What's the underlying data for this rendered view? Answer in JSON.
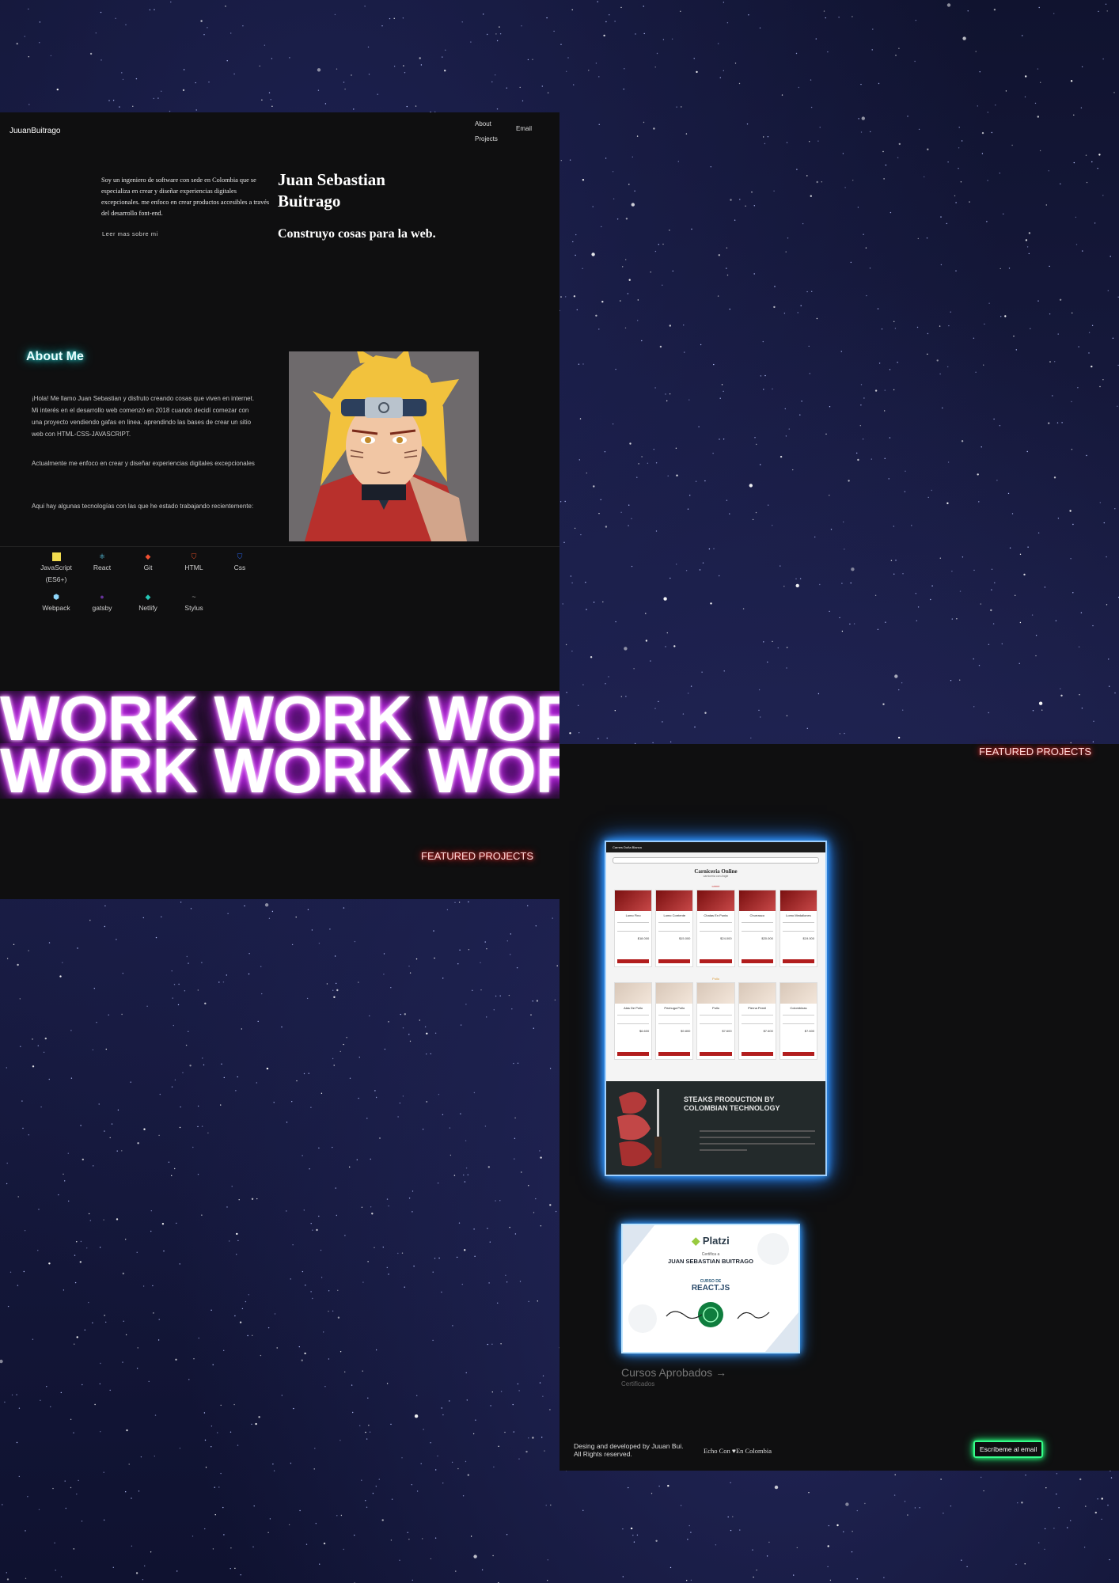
{
  "header": {
    "brand": "JuuanBuitrago",
    "nav": {
      "about": "About",
      "projects": "Projects",
      "email": "Email"
    }
  },
  "hero": {
    "intro": "Soy un ingeniero de software con sede en Colombia que se especializa en crear y diseñar experiencias digitales excepcionales. me enfoco en crear productos accesibles a través del desarrollo font-end.",
    "read_more": "Leer mas sobre mi",
    "name": "Juan Sebastian Buitrago",
    "tagline": "Construyo cosas para la web."
  },
  "about": {
    "title": "About Me",
    "paragraphs": [
      "¡Hola! Me llamo Juan Sebastian y disfruto creando cosas que viven en internet. Mi interés en el desarrollo web comenzó en 2018 cuando decidí comezar con una proyecto vendiendo gafas en linea. aprendindo las bases de crear un sitio web con HTML-CSS-JAVASCRIPT.",
      "Actualmente me enfoco en crear y diseñar experiencias digitales excepcionales",
      "Aqui hay algunas tecnologías con las que he estado trabajando recientemente:"
    ],
    "portrait_icon": "anime-portrait"
  },
  "technologies": [
    {
      "label": "JavaScript (ES6+)",
      "icon": "js-icon",
      "color": "#f0db4f"
    },
    {
      "label": "React",
      "icon": "react-icon",
      "color": "#61dafb"
    },
    {
      "label": "Git",
      "icon": "git-icon",
      "color": "#f05032"
    },
    {
      "label": "HTML",
      "icon": "html-icon",
      "color": "#e44d26"
    },
    {
      "label": "Css",
      "icon": "css-icon",
      "color": "#2965f1"
    },
    {
      "label": "Webpack",
      "icon": "webpack-icon",
      "color": "#8ed6fb"
    },
    {
      "label": "gatsby",
      "icon": "gatsby-icon",
      "color": "#663399"
    },
    {
      "label": "Netlify",
      "icon": "netlify-icon",
      "color": "#25c7b7"
    },
    {
      "label": "Stylus",
      "icon": "stylus-icon",
      "color": "#999999"
    }
  ],
  "marquee": {
    "row1": "WORK WORK WORK WORK",
    "row2": "WORK WORK WORK WORK",
    "glow_color": "#c11cf0"
  },
  "featured": {
    "heading_left": "FEATURED PROJECTS",
    "heading_right": "FEATURED PROJECTS"
  },
  "project": {
    "nav_brand": "Carnes Doña Blanca",
    "title": "Carniceria Online",
    "subtitle": "carnicería con Angie",
    "section1": "carne",
    "section2": "Pollo",
    "items_row1": [
      {
        "name": "Lomo Fino",
        "price": "$18.000"
      },
      {
        "name": "Lomo Corriente",
        "price": "$15.000"
      },
      {
        "name": "Chatas En Punta",
        "price": "$24.000"
      },
      {
        "name": "Churrasco",
        "price": "$20.000"
      },
      {
        "name": "Lomo Medallones",
        "price": "$19.000"
      }
    ],
    "items_row2": [
      {
        "name": "Alas De Pollo",
        "price": "$6.600"
      },
      {
        "name": "Pechuga Pollo",
        "price": "$9.800"
      },
      {
        "name": "Pollo",
        "price": "$7.600"
      },
      {
        "name": "Pierna Pernil",
        "price": "$7.600"
      },
      {
        "name": "Colombinas",
        "price": "$7.600"
      }
    ],
    "banner_title": "STEAKS PRODUCTION BY COLOMBIAN TECHNOLOGY"
  },
  "certificate": {
    "brand": "Platzi",
    "certifies": "Certifica a",
    "student": "JUAN SEBASTIAN BUITRAGO",
    "course_label": "CURSO DE",
    "course": "REACT.JS"
  },
  "courses": {
    "link": "Cursos Aprobados →",
    "sub": "Certificados"
  },
  "footer": {
    "credit_line1": "Desing and developed by Juuan Bui.",
    "credit_line2": "All Rights reserved.",
    "made_prefix": "Echo Con",
    "made_suffix": "En Colombia",
    "email_button": "Escríbeme al email",
    "email_glow": "#29ff7a"
  }
}
